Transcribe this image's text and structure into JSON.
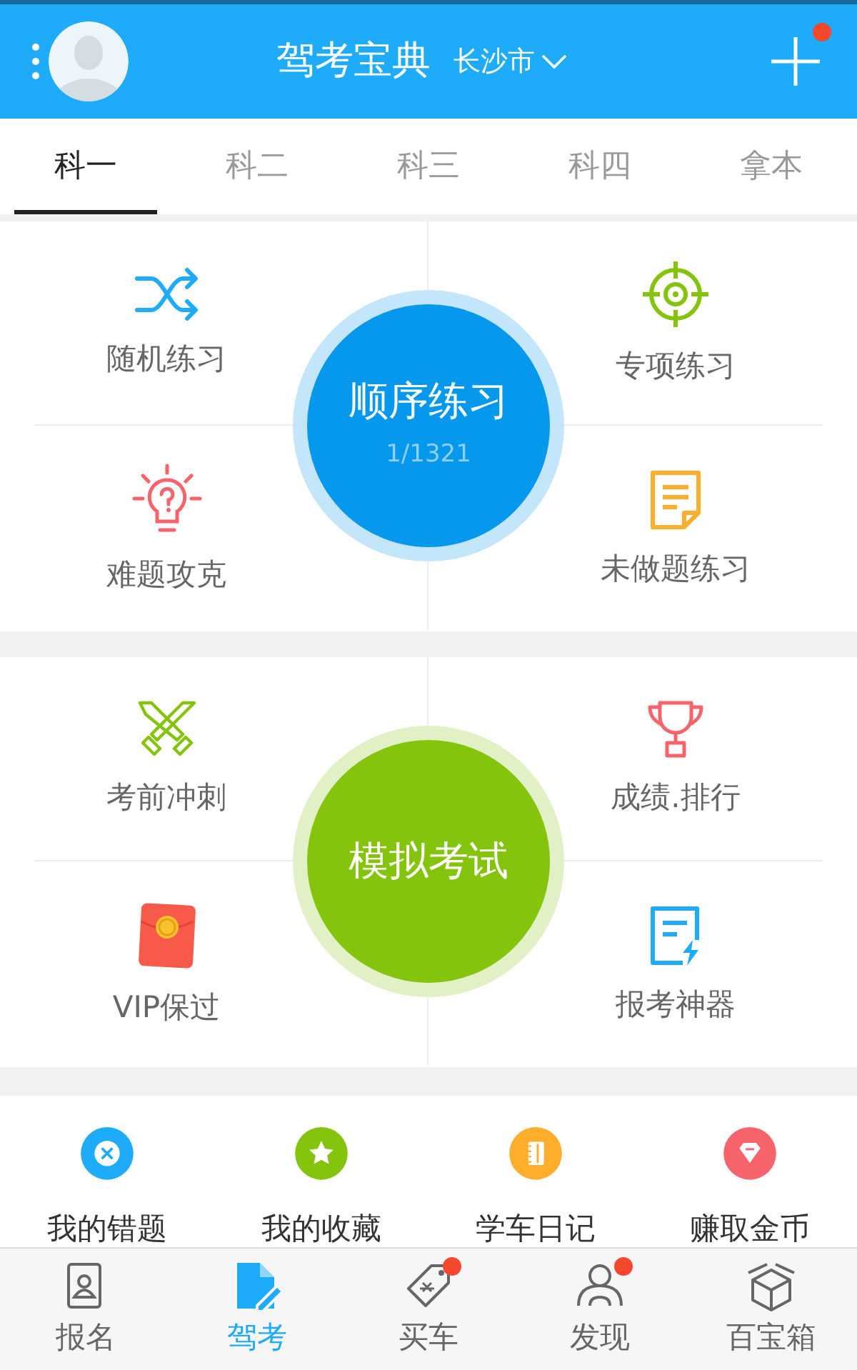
{
  "header": {
    "title": "驾考宝典",
    "city": "长沙市",
    "notification_dot": true
  },
  "tabs": [
    {
      "label": "科一",
      "selected": true
    },
    {
      "label": "科二",
      "selected": false
    },
    {
      "label": "科三",
      "selected": false
    },
    {
      "label": "科四",
      "selected": false
    },
    {
      "label": "拿本",
      "selected": false
    }
  ],
  "sections": [
    {
      "center": {
        "title": "顺序练习",
        "subtitle": "1/1321",
        "color": "#0598ec"
      },
      "items": [
        {
          "label": "随机练习"
        },
        {
          "label": "专项练习"
        },
        {
          "label": "难题攻克"
        },
        {
          "label": "未做题练习"
        }
      ]
    },
    {
      "center": {
        "title": "模拟考试",
        "color": "#85c40d"
      },
      "items": [
        {
          "label": "考前冲刺"
        },
        {
          "label": "成绩.排行"
        },
        {
          "label": "VIP保过"
        },
        {
          "label": "报考神器"
        }
      ]
    }
  ],
  "shortcuts": [
    {
      "label": "我的错题",
      "color": "#1eabf9"
    },
    {
      "label": "我的收藏",
      "color": "#85c40d"
    },
    {
      "label": "学车日记",
      "color": "#feae2a"
    },
    {
      "label": "赚取金币",
      "color": "#f6636a"
    }
  ],
  "bottom_nav": [
    {
      "label": "报名",
      "selected": false,
      "dot": false
    },
    {
      "label": "驾考",
      "selected": true,
      "dot": false
    },
    {
      "label": "买车",
      "selected": false,
      "dot": true
    },
    {
      "label": "发现",
      "selected": false,
      "dot": true
    },
    {
      "label": "百宝箱",
      "selected": false,
      "dot": false
    }
  ]
}
